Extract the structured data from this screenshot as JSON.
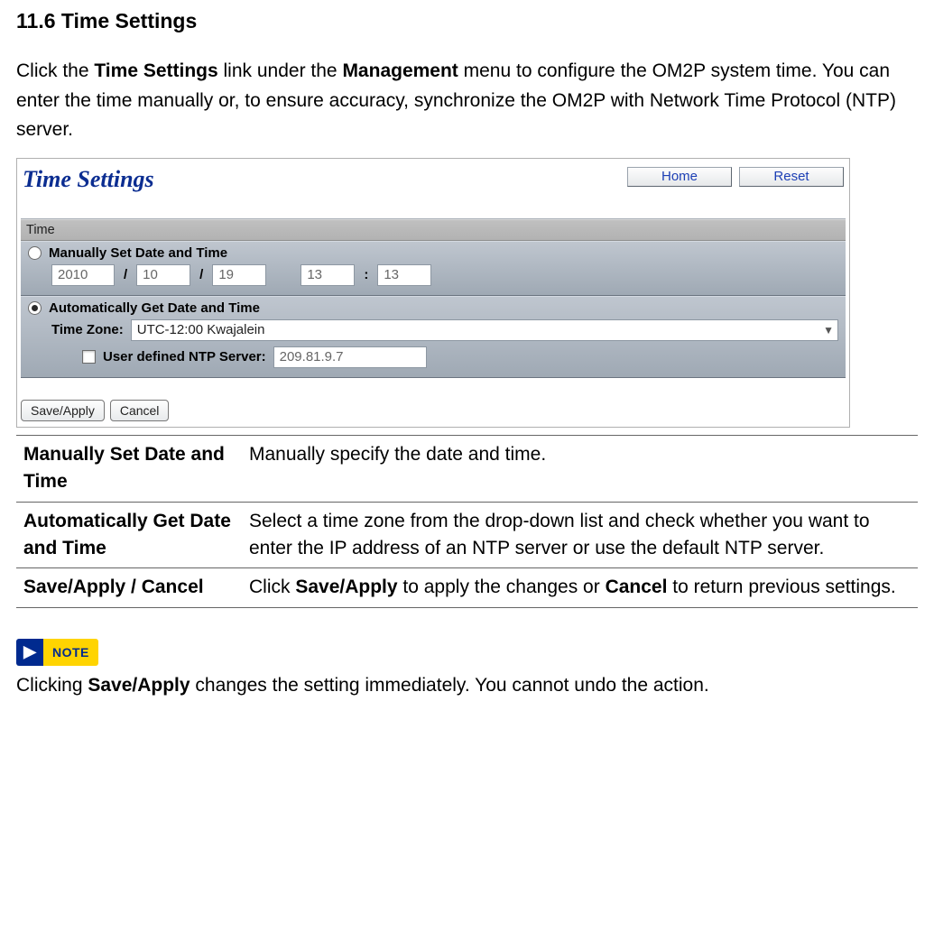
{
  "heading": "11.6 Time Settings",
  "intro": {
    "pre1": "Click the ",
    "bold1": "Time Settings",
    "mid1": " link under the ",
    "bold2": "Management",
    "post1": " menu to configure the OM2P system time. You can enter the time manually or, to ensure accuracy, synchronize the OM2P with Network Time Protocol (NTP) server."
  },
  "screenshot": {
    "page_title": "Time Settings",
    "home_btn": "Home",
    "reset_btn": "Reset",
    "section_time": "Time",
    "manual_label": "Manually Set Date and Time",
    "date": {
      "year": "2010",
      "month": "10",
      "day": "19",
      "hour": "13",
      "minute": "13"
    },
    "auto_label": "Automatically Get Date and Time",
    "tz_label": "Time Zone:",
    "tz_value": "UTC-12:00 Kwajalein",
    "ntp_label": "User defined NTP Server:",
    "ntp_value": "209.81.9.7",
    "save_btn": "Save/Apply",
    "cancel_btn": "Cancel"
  },
  "definitions": [
    {
      "term": "Manually Set Date and Time",
      "desc": "Manually specify the date and time."
    },
    {
      "term": "Automatically Get Date and Time",
      "desc": "Select a time zone from the drop-down list and check whether you want to enter the IP address of an NTP server or use the default NTP server."
    },
    {
      "term": "Save/Apply / Cancel",
      "desc_pre": "Click ",
      "desc_b1": "Save/Apply",
      "desc_mid": " to apply the changes or ",
      "desc_b2": "Cancel",
      "desc_post": " to return previous settings."
    }
  ],
  "note_badge": "NOTE",
  "note_text": {
    "pre": "Clicking ",
    "b": "Save/Apply",
    "post": " changes the setting immediately. You cannot undo the action."
  }
}
